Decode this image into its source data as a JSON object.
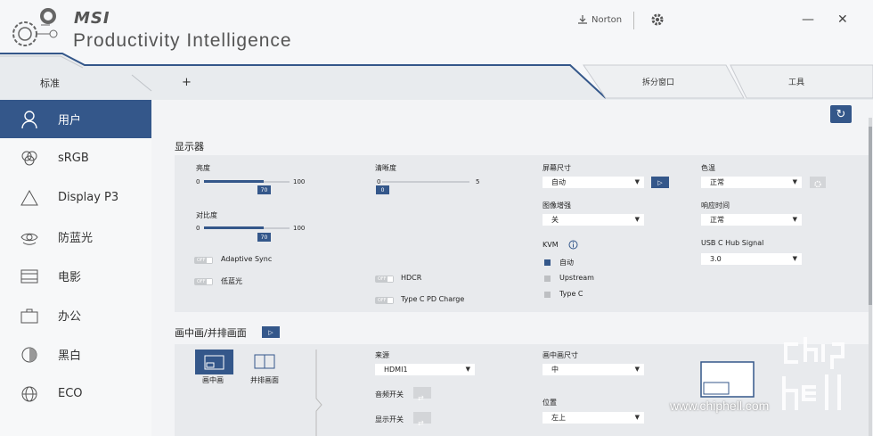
{
  "header": {
    "brand": "MSI",
    "product": "Productivity Intelligence",
    "norton_label": "Norton"
  },
  "tabs": {
    "standard": "标准",
    "add": "+",
    "split_window": "拆分窗口",
    "tools": "工具"
  },
  "sidebar": {
    "items": [
      {
        "label": "用户",
        "icon": "user-icon",
        "active": true
      },
      {
        "label": "sRGB",
        "icon": "rgb-icon"
      },
      {
        "label": "Display P3",
        "icon": "triangle-icon"
      },
      {
        "label": "防蓝光",
        "icon": "eye-icon"
      },
      {
        "label": "电影",
        "icon": "film-icon"
      },
      {
        "label": "办公",
        "icon": "briefcase-icon"
      },
      {
        "label": "黑白",
        "icon": "bw-icon"
      },
      {
        "label": "ECO",
        "icon": "globe-icon"
      }
    ]
  },
  "display": {
    "title": "显示器",
    "brightness": {
      "label": "亮度",
      "min": "0",
      "max": "100",
      "value": "70"
    },
    "contrast": {
      "label": "对比度",
      "min": "0",
      "max": "100",
      "value": "70"
    },
    "sharpness": {
      "label": "清晰度",
      "min": "0",
      "max": "5",
      "value": "0"
    },
    "adaptive_sync": {
      "label": "Adaptive Sync",
      "state": "OFF"
    },
    "low_blue": {
      "label": "低蓝光",
      "state": "OFF"
    },
    "hdcr": {
      "label": "HDCR",
      "state": "OFF"
    },
    "typec_pd": {
      "label": "Type C PD Charge",
      "state": "OFF"
    },
    "screen_size": {
      "label": "屏幕尺寸",
      "value": "自动"
    },
    "image_enhance": {
      "label": "图像增强",
      "value": "关"
    },
    "kvm": {
      "label": "KVM",
      "options": [
        "自动",
        "Upstream",
        "Type C"
      ],
      "selected": "自动"
    },
    "color_temp": {
      "label": "色温",
      "value": "正常"
    },
    "response_time": {
      "label": "响应时间",
      "value": "正常"
    },
    "usbc_hub": {
      "label": "USB C Hub Signal",
      "value": "3.0"
    }
  },
  "pip": {
    "title": "画中画/并排画面",
    "mode_pip": "画中画",
    "mode_pbp": "并排画面",
    "source": {
      "label": "来源",
      "value": "HDMI1"
    },
    "audio_switch": {
      "label": "音频开关"
    },
    "display_switch": {
      "label": "显示开关"
    },
    "pip_size": {
      "label": "画中画尺寸",
      "value": "中"
    },
    "position": {
      "label": "位置",
      "value": "左上"
    }
  },
  "watermark": "www.chiphell.com",
  "colors": {
    "accent": "#34578a",
    "panel": "#e8eaed"
  }
}
